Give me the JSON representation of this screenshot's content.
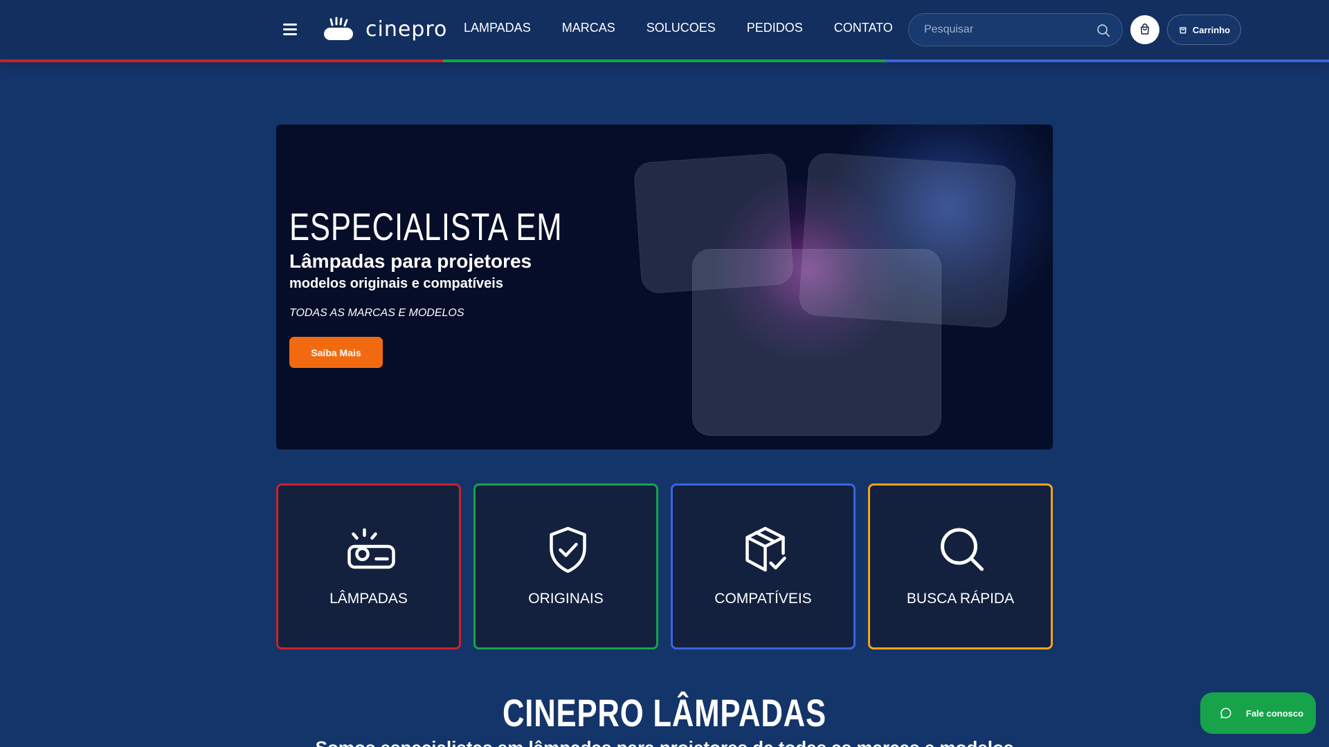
{
  "brand": {
    "name": "cinepro"
  },
  "nav": {
    "items": [
      {
        "label": "LAMPADAS"
      },
      {
        "label": "MARCAS"
      },
      {
        "label": "SOLUCOES"
      },
      {
        "label": "PEDIDOS"
      },
      {
        "label": "CONTATO"
      }
    ]
  },
  "search": {
    "placeholder": "Pesquisar",
    "icon": "search-icon"
  },
  "cart": {
    "label": "Carrinho",
    "icon": "shopping-bag-icon"
  },
  "colors": {
    "accent_red": "#c8232c",
    "accent_green": "#16a34a",
    "accent_blue": "#3b63e0",
    "accent_orange": "#f5a316",
    "cta_orange": "#f26a10",
    "background": "#14356a"
  },
  "hero": {
    "title": "ESPECIALISTA EM",
    "subtitle": "Lâmpadas para projetores",
    "subtitle2": "modelos originais e compatíveis",
    "tagline": "TODAS AS MARCAS E MODELOS",
    "cta": "Saiba Mais"
  },
  "categories": [
    {
      "label": "LÂMPADAS",
      "icon": "projector-lamp-icon",
      "color": "#c8232c"
    },
    {
      "label": "ORIGINAIS",
      "icon": "shield-check-icon",
      "color": "#16a34a"
    },
    {
      "label": "COMPATÍVEIS",
      "icon": "package-check-icon",
      "color": "#3b63e0"
    },
    {
      "label": "BUSCA RÁPIDA",
      "icon": "search-icon",
      "color": "#f5a316"
    }
  ],
  "section": {
    "title": "CINEPRO LÂMPADAS",
    "subtitle": "Somos especialistas em lâmpadas para projetores de todas as marcas e modelos"
  },
  "chat": {
    "label": "Fale conosco",
    "icon": "chat-bubble-icon"
  }
}
